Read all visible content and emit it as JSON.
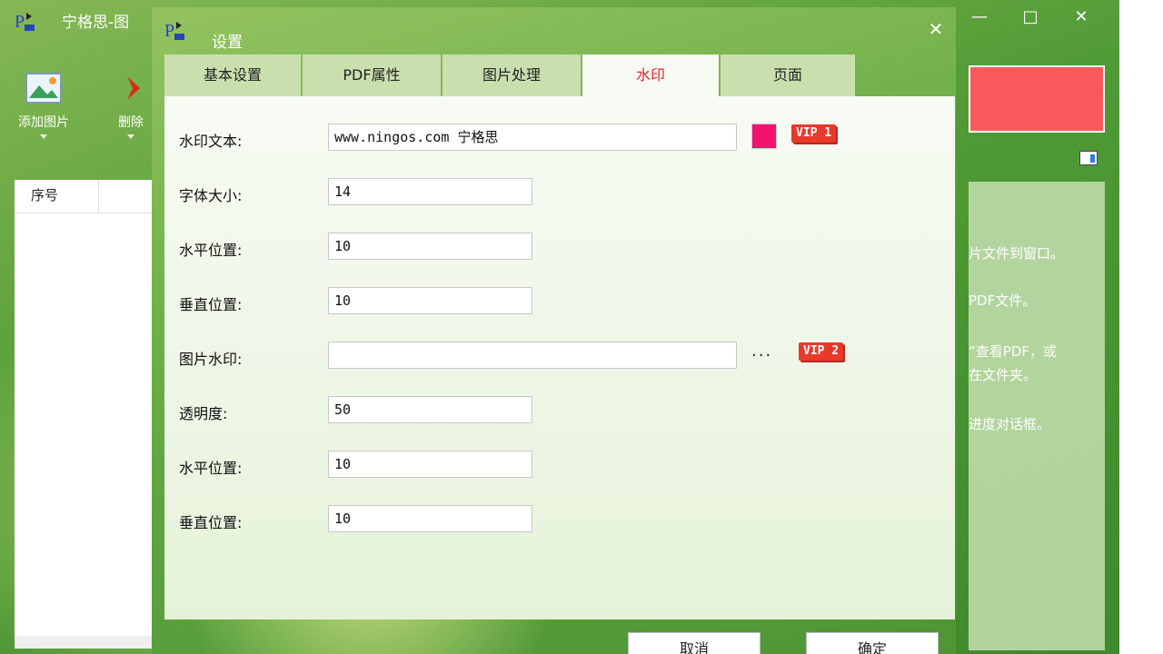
{
  "main_window": {
    "title": "宁格思-图",
    "toolbar": [
      {
        "label": "添加图片"
      },
      {
        "label": "删除"
      }
    ],
    "list_header": "序号",
    "help_lines": [
      "片文件到窗口。",
      "PDF文件。",
      "”查看PDF，或",
      "在文件夹。",
      "进度对话框。"
    ],
    "colors": {
      "accent_red": "#f8595a",
      "window_green": "#4f9a35"
    }
  },
  "dialog": {
    "title": "设置",
    "tabs": [
      {
        "label": "基本设置",
        "active": false
      },
      {
        "label": "PDF属性",
        "active": false
      },
      {
        "label": "图片处理",
        "active": false
      },
      {
        "label": "水印",
        "active": true
      },
      {
        "label": "页面",
        "active": false
      }
    ],
    "fields": {
      "watermark_text": {
        "label": "水印文本:",
        "value": "www.ningos.com 宁格思",
        "color": "#f0146f",
        "vip": "VIP 1"
      },
      "font_size": {
        "label": "字体大小:",
        "value": "14"
      },
      "text_h_pos": {
        "label": "水平位置:",
        "value": "10"
      },
      "text_v_pos": {
        "label": "垂直位置:",
        "value": "10"
      },
      "image_watermark": {
        "label": "图片水印:",
        "value": "",
        "browse": "...",
        "vip": "VIP 2"
      },
      "opacity": {
        "label": "透明度:",
        "value": "50"
      },
      "img_h_pos": {
        "label": "水平位置:",
        "value": "10"
      },
      "img_v_pos": {
        "label": "垂直位置:",
        "value": "10"
      }
    },
    "buttons": {
      "cancel": "取消",
      "ok": "确定"
    }
  }
}
